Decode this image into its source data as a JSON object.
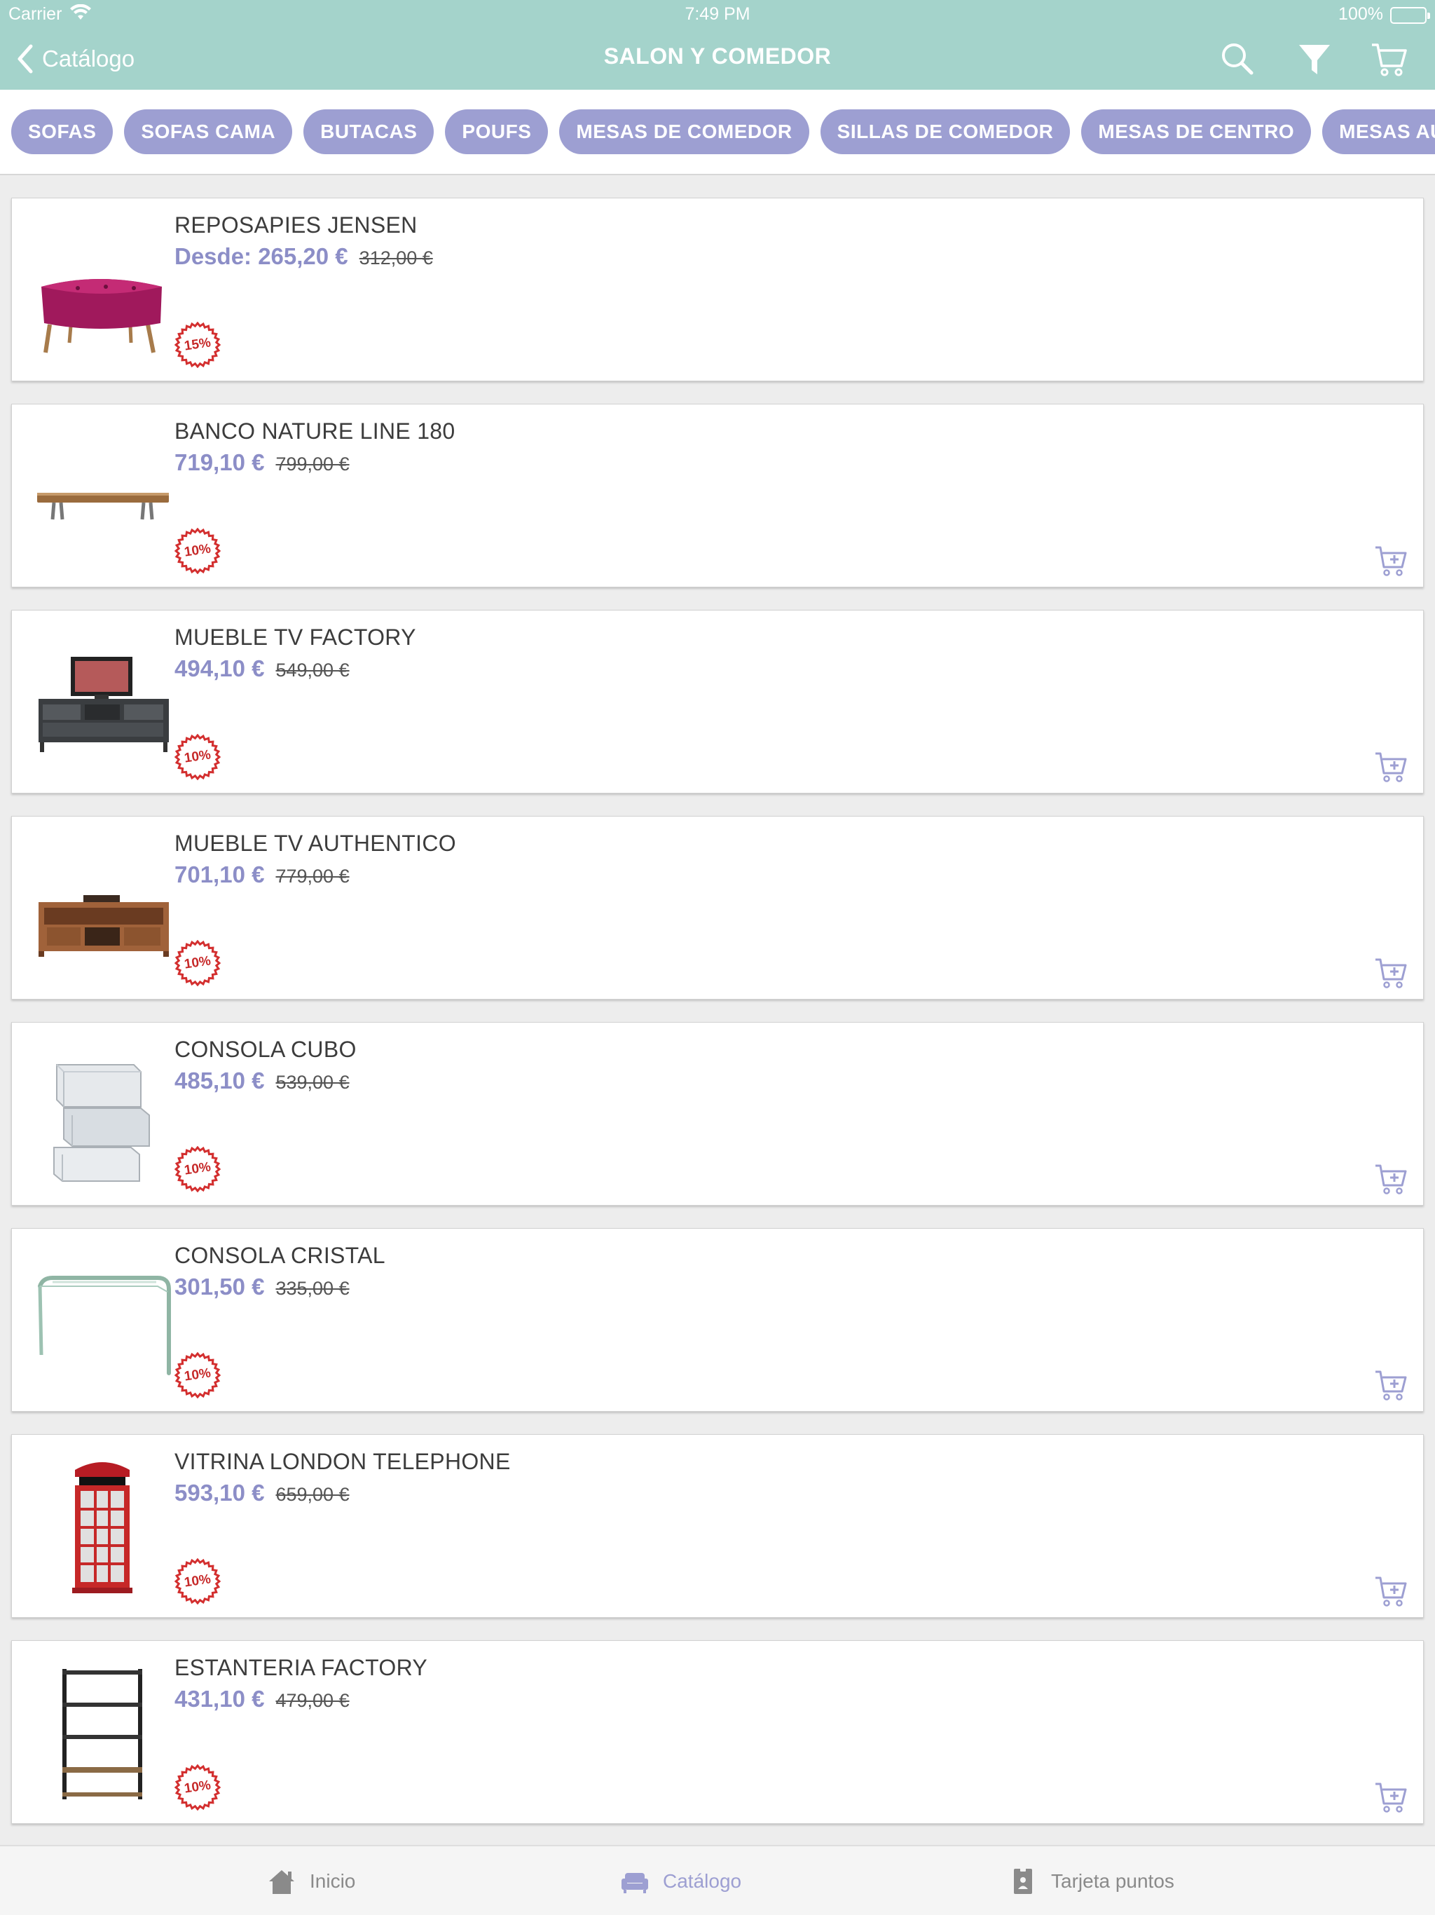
{
  "status_bar": {
    "carrier": "Carrier",
    "time": "7:49 PM",
    "battery": "100%"
  },
  "nav": {
    "back_label": "Catálogo",
    "title": "SALON Y COMEDOR",
    "header_color": "#a4d3cb"
  },
  "categories": [
    "SOFAS",
    "SOFAS CAMA",
    "BUTACAS",
    "POUFS",
    "MESAS DE COMEDOR",
    "SILLAS DE COMEDOR",
    "MESAS DE CENTRO",
    "MESAS AUXILIARES"
  ],
  "accent_color": "#9d9fd2",
  "products": [
    {
      "name": "REPOSAPIES JENSEN",
      "price": "Desde: 265,20 €",
      "old_price": "312,00 €",
      "badge": "15%",
      "has_cart": false,
      "image": "pouf"
    },
    {
      "name": "BANCO NATURE LINE 180",
      "price": "719,10 €",
      "old_price": "799,00 €",
      "badge": "10%",
      "has_cart": true,
      "image": "bench"
    },
    {
      "name": "MUEBLE TV FACTORY",
      "price": "494,10 €",
      "old_price": "549,00 €",
      "badge": "10%",
      "has_cart": true,
      "image": "tv-unit-dark"
    },
    {
      "name": "MUEBLE TV AUTHENTICO",
      "price": "701,10 €",
      "old_price": "779,00 €",
      "badge": "10%",
      "has_cart": true,
      "image": "tv-unit-wood"
    },
    {
      "name": "CONSOLA CUBO",
      "price": "485,10 €",
      "old_price": "539,00 €",
      "badge": "10%",
      "has_cart": true,
      "image": "mirror-cubes"
    },
    {
      "name": "CONSOLA CRISTAL",
      "price": "301,50 €",
      "old_price": "335,00 €",
      "badge": "10%",
      "has_cart": true,
      "image": "glass-console"
    },
    {
      "name": "VITRINA LONDON TELEPHONE",
      "price": "593,10 €",
      "old_price": "659,00 €",
      "badge": "10%",
      "has_cart": true,
      "image": "phone-booth"
    },
    {
      "name": "ESTANTERIA FACTORY",
      "price": "431,10 €",
      "old_price": "479,00 €",
      "badge": "10%",
      "has_cart": true,
      "image": "shelf"
    }
  ],
  "tabbar": [
    {
      "label": "Inicio",
      "icon": "home-icon",
      "active": false
    },
    {
      "label": "Catálogo",
      "icon": "sofa-icon",
      "active": true
    },
    {
      "label": "Tarjeta puntos",
      "icon": "badge-card-icon",
      "active": false
    }
  ]
}
